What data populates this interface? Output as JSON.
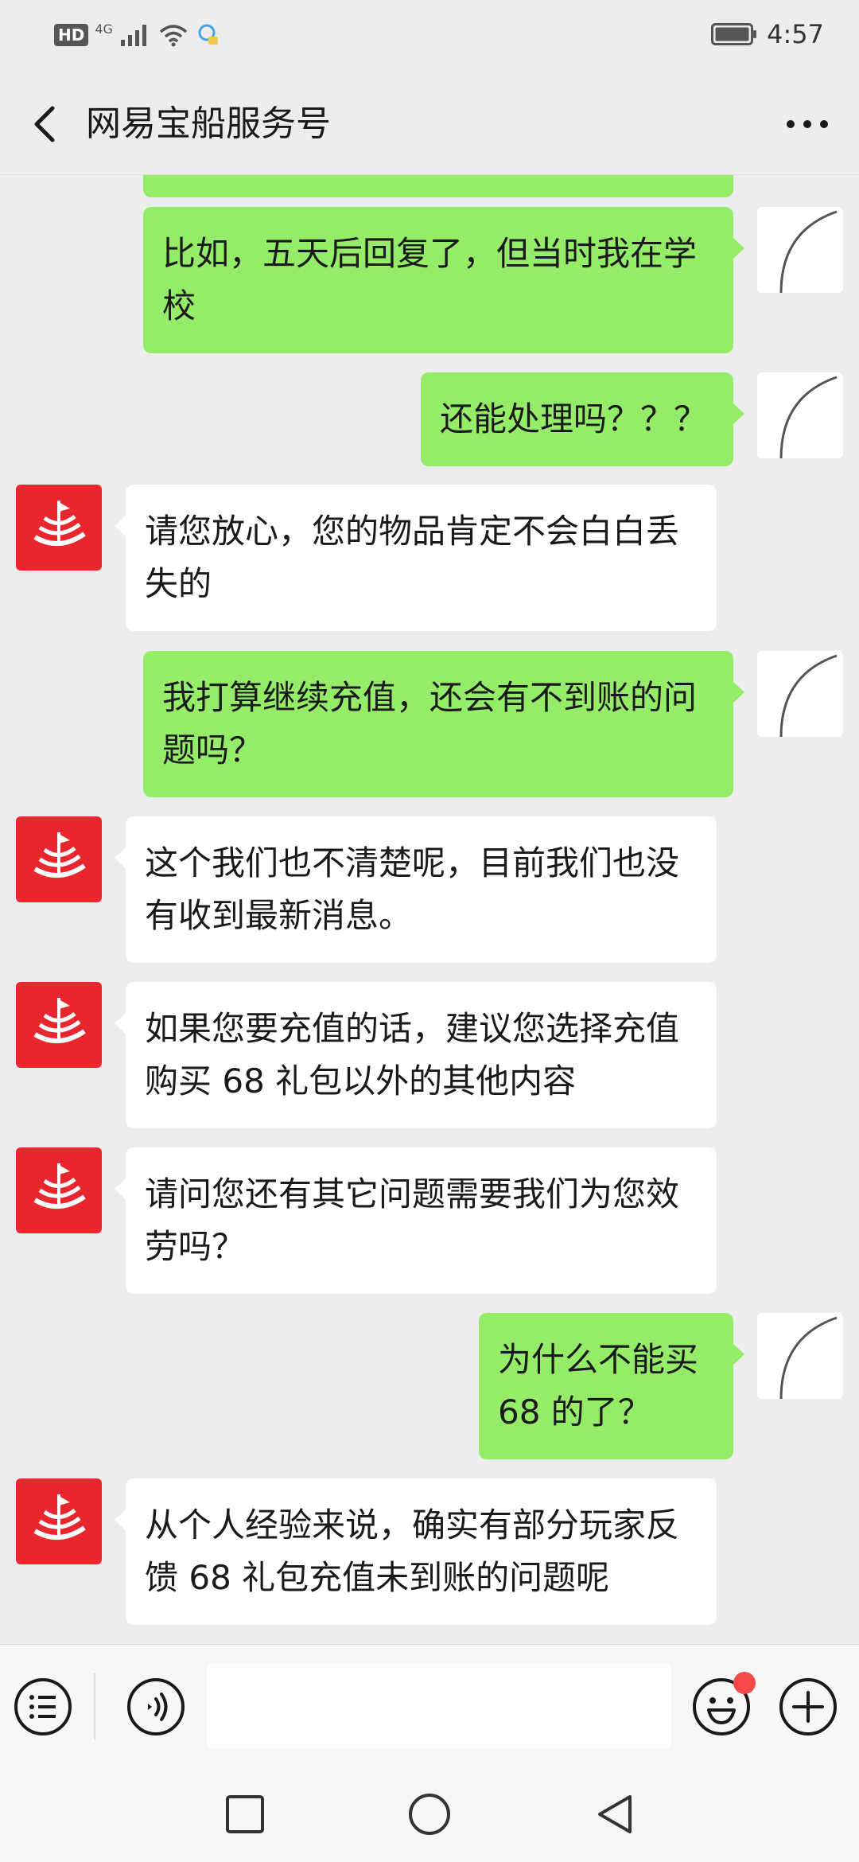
{
  "status_bar": {
    "hd_badge": "HD",
    "network_type": "4G",
    "time": "4:57"
  },
  "header": {
    "title": "网易宝船服务号"
  },
  "messages": [
    {
      "sender": "me",
      "text": "比如，五天后回复了，但当时我在学校"
    },
    {
      "sender": "me",
      "text": "还能处理吗？？？"
    },
    {
      "sender": "bot",
      "text": "请您放心，您的物品肯定不会白白丢失的"
    },
    {
      "sender": "me",
      "text": "我打算继续充值，还会有不到账的问题吗？"
    },
    {
      "sender": "bot",
      "text": "这个我们也不清楚呢，目前我们也没有收到最新消息。"
    },
    {
      "sender": "bot",
      "text": "如果您要充值的话，建议您选择充值购买 68 礼包以外的其他内容"
    },
    {
      "sender": "bot",
      "text": "请问您还有其它问题需要我们为您效劳吗？"
    },
    {
      "sender": "me",
      "text": "为什么不能买 68 的了？"
    },
    {
      "sender": "bot",
      "text": "从个人经验来说，确实有部分玩家反馈 68 礼包充值未到账的问题呢"
    }
  ],
  "input_bar": {
    "menu_icon": "list-icon",
    "voice_icon": "voice-icon",
    "emoji_icon": "emoji-icon",
    "plus_icon": "plus-icon",
    "message_value": "",
    "has_notification_dot": true
  },
  "colors": {
    "my_bubble": "#95ec69",
    "bot_bubble": "#ffffff",
    "background": "#ededed",
    "brand_red": "#e8262d"
  }
}
